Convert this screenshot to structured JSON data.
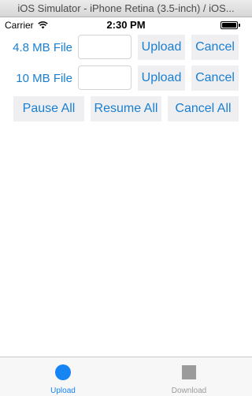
{
  "window": {
    "title": "iOS Simulator - iPhone Retina (3.5-inch) / iOS..."
  },
  "status_bar": {
    "carrier": "Carrier",
    "time": "2:30 PM",
    "wifi_icon": "wifi-icon",
    "battery_icon": "battery-icon"
  },
  "rows": [
    {
      "label": "4.8 MB File",
      "field_value": "",
      "upload_label": "Upload",
      "cancel_label": "Cancel"
    },
    {
      "label": "10 MB File",
      "field_value": "",
      "upload_label": "Upload",
      "cancel_label": "Cancel"
    }
  ],
  "bulk_actions": {
    "pause_all": "Pause All",
    "resume_all": "Resume All",
    "cancel_all": "Cancel All"
  },
  "tab_bar": {
    "tabs": [
      {
        "label": "Upload",
        "icon": "circle-icon",
        "selected": true
      },
      {
        "label": "Download",
        "icon": "square-icon",
        "selected": false
      }
    ]
  },
  "colors": {
    "accent": "#1a7fd1",
    "tab_selected": "#1784f3",
    "tab_unselected": "#9b9b9b",
    "button_bg": "#efeff1"
  }
}
